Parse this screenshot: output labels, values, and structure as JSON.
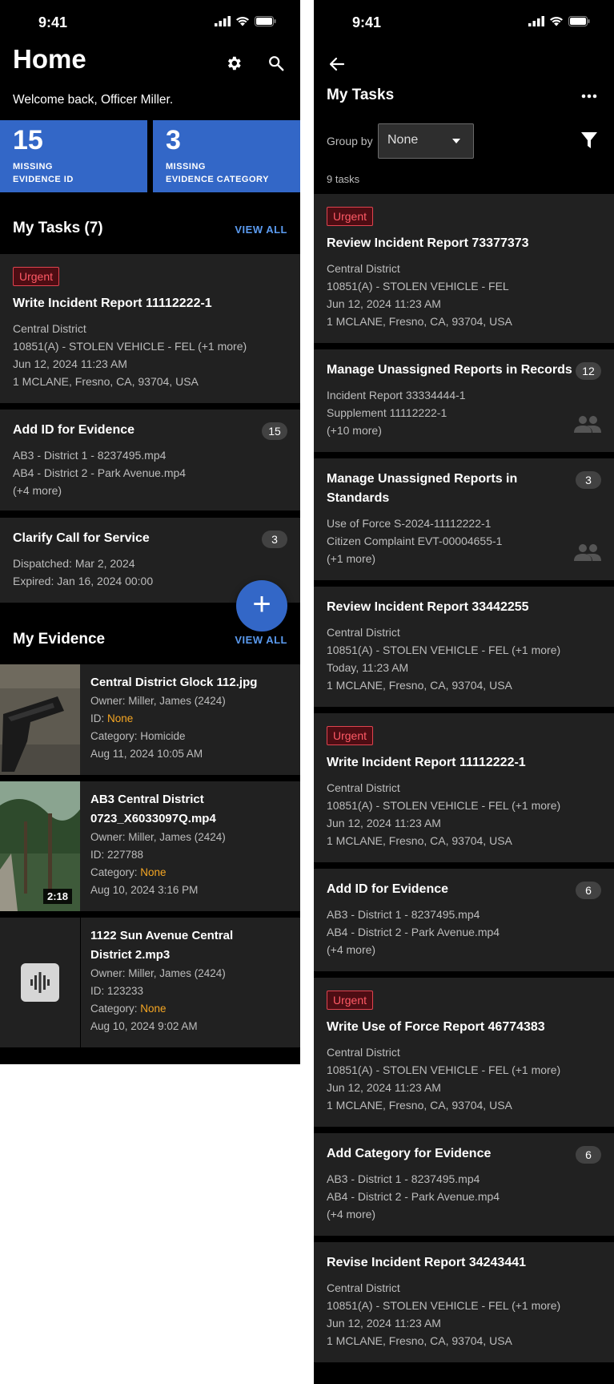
{
  "status_bar": {
    "time": "9:41"
  },
  "home": {
    "title": "Home",
    "welcome": "Welcome back, Officer Miller.",
    "stats": [
      {
        "value": "15",
        "label_line1": "MISSING",
        "label_line2": "EVIDENCE ID"
      },
      {
        "value": "3",
        "label_line1": "MISSING",
        "label_line2": "EVIDENCE CATEGORY"
      }
    ],
    "tasks_title": "My Tasks (7)",
    "view_all": "VIEW ALL",
    "tasks": [
      {
        "urgent": "Urgent",
        "title": "Write Incident Report 11112222-1",
        "lines": [
          "Central District",
          "10851(A) - STOLEN VEHICLE - FEL (+1 more)",
          "Jun 12, 2024 11:23 AM",
          "1 MCLANE, Fresno, CA, 93704, USA"
        ]
      },
      {
        "title": "Add ID for Evidence",
        "badge": "15",
        "lines": [
          "AB3 - District 1 - 8237495.mp4",
          "AB4 - District 2 - Park Avenue.mp4",
          "(+4 more)"
        ]
      },
      {
        "title": "Clarify Call for Service",
        "badge": "3",
        "lines": [
          "Dispatched: Mar 2, 2024",
          "Expired: Jan 16, 2024 00:00"
        ]
      }
    ],
    "fab_label": "+",
    "evidence_title": "My Evidence",
    "evidence": [
      {
        "title_lines": [
          "Central District Glock 112.jpg"
        ],
        "owner": "Owner: Miller, James (2424)",
        "id_label": "ID: ",
        "id_value": "None",
        "category_label": "Category: ",
        "category_value": "Homicide",
        "date": "Aug 11, 2024 10:05 AM"
      },
      {
        "title_lines": [
          "AB3 Central District",
          "0723_X6033097Q.mp4"
        ],
        "owner": "Owner: Miller, James (2424)",
        "id_label": "ID: ",
        "id_value": "227788",
        "category_label": "Category: ",
        "category_value": "None",
        "date": "Aug 10, 2024 3:16 PM",
        "duration": "2:18"
      },
      {
        "title_lines": [
          "1122 Sun Avenue Central",
          "District 2.mp3"
        ],
        "owner": "Owner: Miller, James (2424)",
        "id_label": "ID: ",
        "id_value": "123233",
        "category_label": "Category: ",
        "category_value": "None",
        "date": "Aug 10, 2024 9:02 AM"
      }
    ]
  },
  "my_tasks": {
    "title": "My Tasks",
    "group_by_label": "Group by",
    "group_by_value": "None",
    "count": "9 tasks",
    "tasks": [
      {
        "urgent": "Urgent",
        "title_lines": [
          "Review Incident Report 73377373"
        ],
        "lines": [
          "Central District",
          "10851(A) - STOLEN VEHICLE - FEL",
          "Jun 12, 2024 11:23 AM",
          "1 MCLANE, Fresno, CA, 93704, USA"
        ]
      },
      {
        "title_lines": [
          "Manage Unassigned Reports in Records"
        ],
        "badge": "12",
        "group": true,
        "lines": [
          "Incident Report 33334444-1",
          "Supplement 11112222-1",
          "(+10 more)"
        ]
      },
      {
        "title_lines": [
          "Manage Unassigned Reports in",
          "Standards"
        ],
        "badge": "3",
        "group": true,
        "lines": [
          "Use of Force S-2024-11112222-1",
          "Citizen Complaint EVT-00004655-1",
          "(+1 more)"
        ]
      },
      {
        "title_lines": [
          "Review Incident Report 33442255"
        ],
        "lines": [
          "Central District",
          "10851(A) - STOLEN VEHICLE - FEL (+1 more)",
          "Today, 11:23 AM",
          "1 MCLANE, Fresno, CA, 93704, USA"
        ]
      },
      {
        "urgent": "Urgent",
        "title_lines": [
          "Write Incident Report 11112222-1"
        ],
        "lines": [
          "Central District",
          "10851(A) - STOLEN VEHICLE - FEL (+1 more)",
          "Jun 12, 2024 11:23 AM",
          "1 MCLANE, Fresno, CA, 93704, USA"
        ]
      },
      {
        "title_lines": [
          "Add ID for Evidence"
        ],
        "badge": "6",
        "lines": [
          "AB3 - District 1 - 8237495.mp4",
          "AB4 - District 2 - Park Avenue.mp4",
          "(+4 more)"
        ]
      },
      {
        "urgent": "Urgent",
        "title_lines": [
          "Write Use of Force Report 46774383"
        ],
        "lines": [
          "Central District",
          "10851(A) - STOLEN VEHICLE - FEL (+1 more)",
          "Jun 12, 2024 11:23 AM",
          "1 MCLANE, Fresno, CA, 93704, USA"
        ]
      },
      {
        "title_lines": [
          "Add Category for Evidence"
        ],
        "badge": "6",
        "lines": [
          "AB3 - District 1 - 8237495.mp4",
          "AB4 - District 2 - Park Avenue.mp4",
          "(+4 more)"
        ]
      },
      {
        "title_lines": [
          "Revise Incident Report 34243441"
        ],
        "lines": [
          "Central District",
          "10851(A) - STOLEN VEHICLE - FEL (+1 more)",
          "Jun 12, 2024 11:23 AM",
          "1 MCLANE, Fresno, CA, 93704, USA"
        ]
      }
    ]
  },
  "colors": {
    "accent_blue": "#3367c7",
    "link_blue": "#5b9bf0",
    "urgent_red": "#e0434f",
    "warning_orange": "#f5a623",
    "card_bg": "#212121"
  }
}
